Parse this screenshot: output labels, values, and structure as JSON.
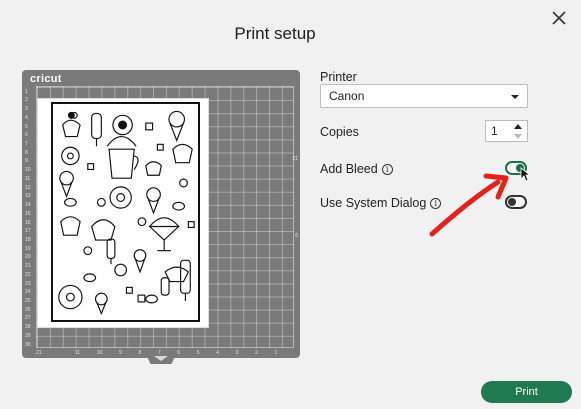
{
  "dialog": {
    "title": "Print setup"
  },
  "mat": {
    "brand": "cricut",
    "left_ruler": [
      "",
      "1",
      "2",
      "3",
      "4",
      "5",
      "6",
      "7",
      "8",
      "9",
      "10",
      "11",
      "12",
      "13",
      "14",
      "15",
      "16",
      "17",
      "18",
      "19",
      "20",
      "21",
      "22",
      "23",
      "24",
      "25",
      "26",
      "27",
      "28",
      "29",
      "30"
    ],
    "right_ruler": [
      "",
      "",
      "",
      "",
      "",
      "",
      "",
      "",
      "",
      "21",
      "",
      "",
      "",
      "",
      "",
      "",
      "",
      "",
      "6",
      "",
      "",
      "",
      "",
      "",
      "",
      "",
      "",
      "",
      "",
      "",
      "",
      "",
      ""
    ],
    "bottom_ruler": [
      "21",
      "",
      "11",
      "10",
      "9",
      "8",
      "7",
      "6",
      "5",
      "4",
      "3",
      "2",
      "1",
      ""
    ]
  },
  "printer": {
    "label": "Printer",
    "value": "Canon"
  },
  "copies": {
    "label": "Copies",
    "value": "1"
  },
  "add_bleed": {
    "label": "Add Bleed",
    "info_glyph": "i",
    "state": "on"
  },
  "system_dialog": {
    "label": "Use System Dialog",
    "info_glyph": "i",
    "state": "off"
  },
  "actions": {
    "print_label": "Print"
  },
  "colors": {
    "accent": "#1f7a4f",
    "toggle_on": "#1c6f4d",
    "annotation_arrow": "#e3221c",
    "mat": "#7a7a7a"
  },
  "icons": {
    "close": "close-icon",
    "caret": "chevron-down-icon",
    "info": "info-icon"
  }
}
